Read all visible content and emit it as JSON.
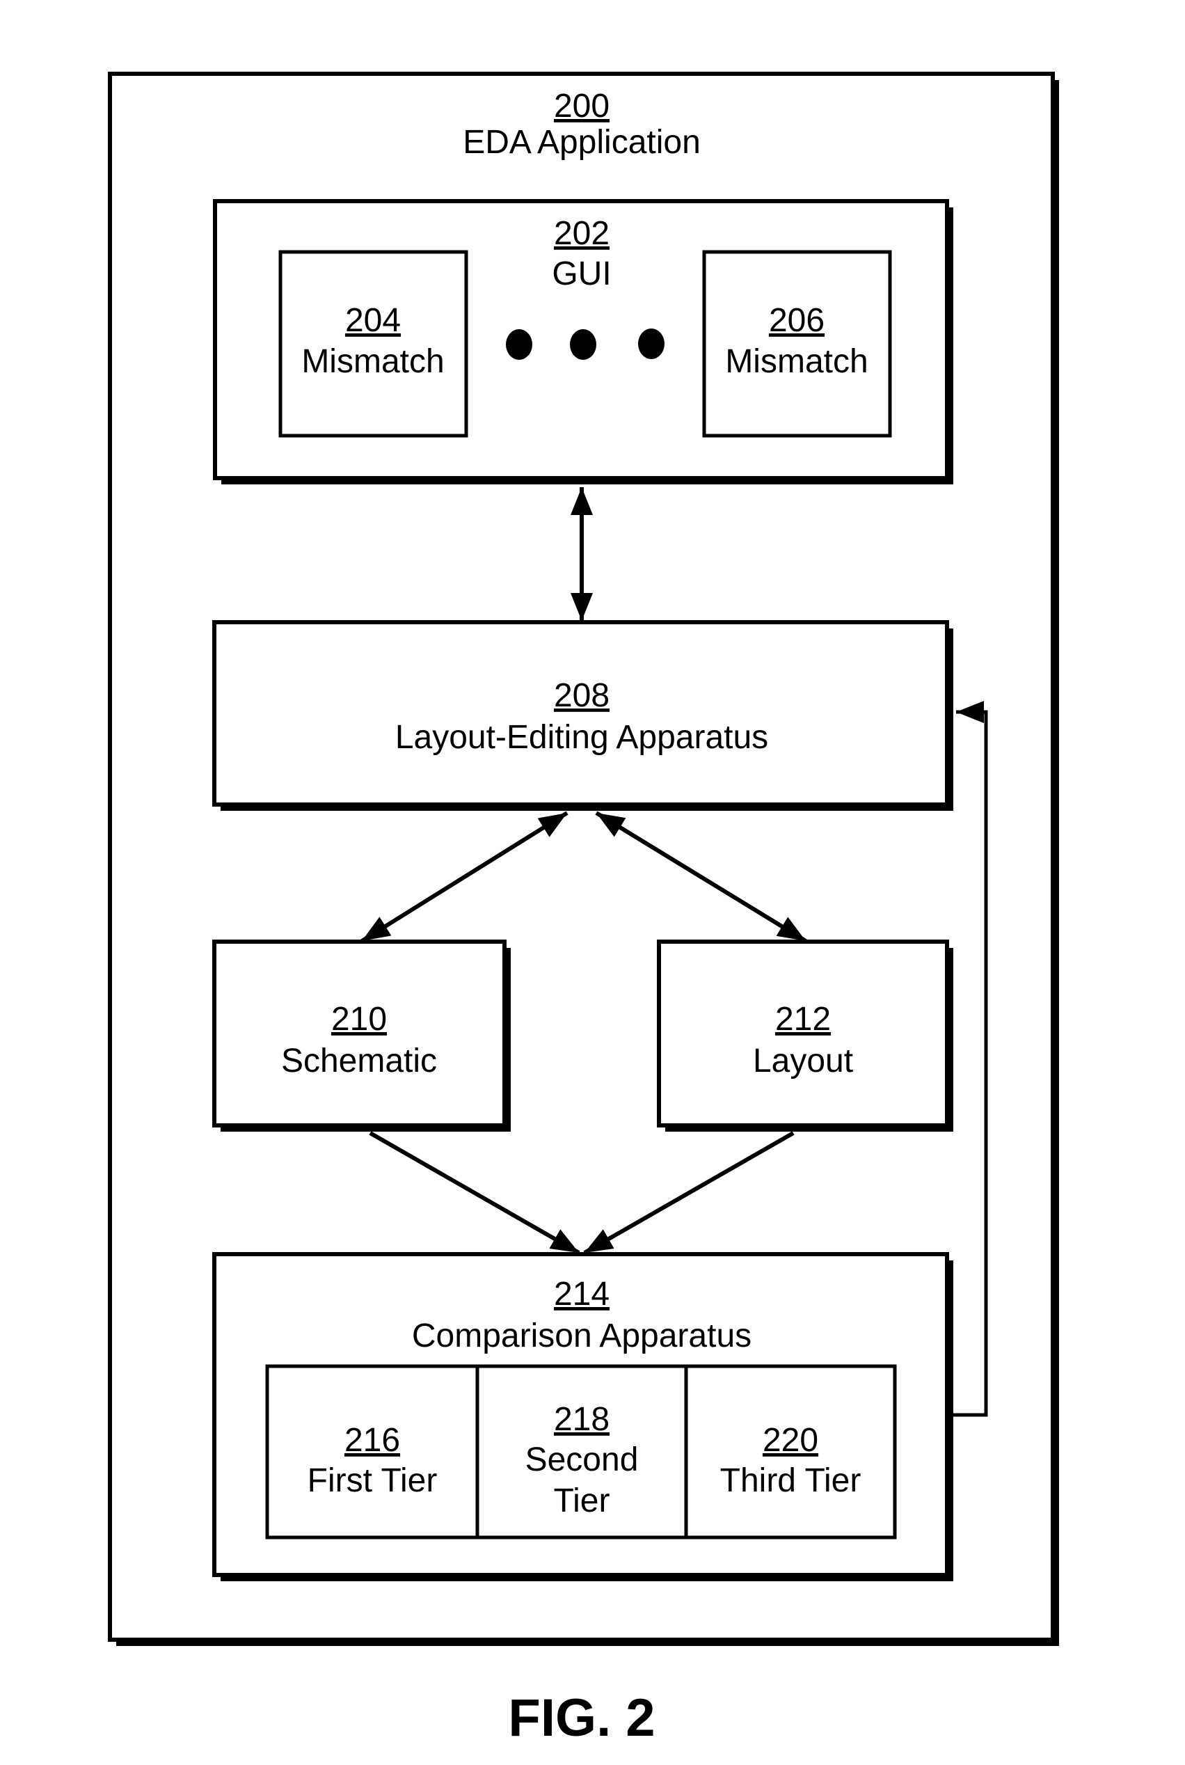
{
  "figure": {
    "caption": "FIG. 2",
    "colors": {
      "stroke": "#000000",
      "background": "#ffffff"
    }
  },
  "blocks": {
    "eda_app": {
      "number": "200",
      "label": "EDA Application"
    },
    "gui": {
      "number": "202",
      "label": "GUI"
    },
    "mismatch_a": {
      "number": "204",
      "label": "Mismatch"
    },
    "mismatch_b": {
      "number": "206",
      "label": "Mismatch"
    },
    "ellipsis": {
      "symbol": "• • •"
    },
    "layout_editing": {
      "number": "208",
      "label": "Layout-Editing Apparatus"
    },
    "schematic": {
      "number": "210",
      "label": "Schematic"
    },
    "layout": {
      "number": "212",
      "label": "Layout"
    },
    "comparison": {
      "number": "214",
      "label": "Comparison Apparatus"
    },
    "tier1": {
      "number": "216",
      "label": "First Tier"
    },
    "tier2": {
      "number": "218",
      "label_line1": "Second",
      "label_line2": "Tier"
    },
    "tier3": {
      "number": "220",
      "label": "Third Tier"
    }
  },
  "connections": [
    {
      "from": "202",
      "to": "208",
      "type": "bidirectional"
    },
    {
      "from": "208",
      "to": "210",
      "type": "bidirectional"
    },
    {
      "from": "208",
      "to": "212",
      "type": "bidirectional"
    },
    {
      "from": "210",
      "to": "214",
      "type": "directed"
    },
    {
      "from": "212",
      "to": "214",
      "type": "directed"
    },
    {
      "from": "214",
      "to": "208",
      "type": "directed-feedback"
    }
  ]
}
